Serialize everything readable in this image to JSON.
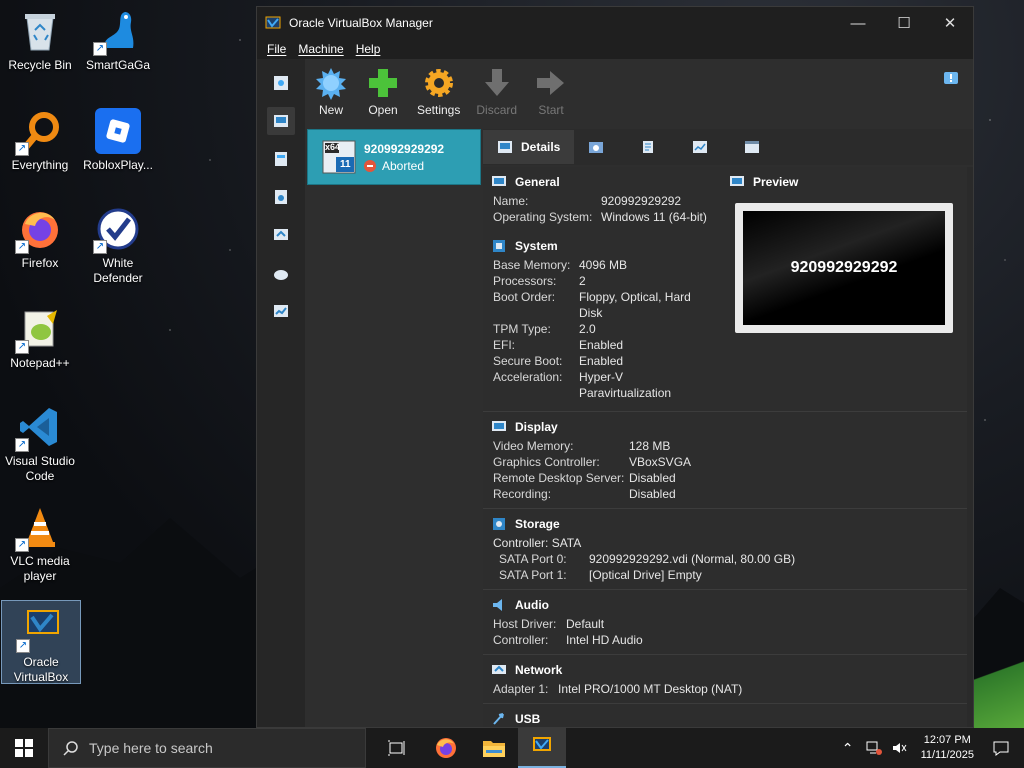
{
  "desktop": {
    "icons": [
      {
        "label": "Recycle Bin",
        "icon": "recycle-bin-icon"
      },
      {
        "label": "SmartGaGa",
        "icon": "smartgaga-icon"
      },
      {
        "label": "Everything",
        "icon": "everything-icon"
      },
      {
        "label": "RobloxPlay...",
        "icon": "roblox-icon"
      },
      {
        "label": "Firefox",
        "icon": "firefox-icon"
      },
      {
        "label": "White Defender",
        "icon": "white-defender-icon"
      },
      {
        "label": "Notepad++",
        "icon": "notepad-plus-plus-icon"
      },
      {
        "label": "Visual Studio Code",
        "icon": "vscode-icon"
      },
      {
        "label": "VLC media player",
        "icon": "vlc-icon"
      },
      {
        "label": "Oracle VirtualBox",
        "icon": "virtualbox-icon"
      }
    ]
  },
  "window": {
    "title": "Oracle VirtualBox Manager",
    "minimize": "—",
    "maximize": "☐",
    "close": "✕",
    "menu": [
      "File",
      "Machine",
      "Help"
    ]
  },
  "toolbar": {
    "new": "New",
    "open": "Open",
    "settings": "Settings",
    "discard": "Discard",
    "start": "Start"
  },
  "vm": {
    "name": "920992929292",
    "state": "Aborted",
    "os_badge_top": "x64",
    "os_badge_bottom": "11"
  },
  "tabs": {
    "details": "Details"
  },
  "details": {
    "general": {
      "title": "General",
      "rows": [
        {
          "k": "Name:",
          "v": "920992929292"
        },
        {
          "k": "Operating System:",
          "v": "Windows 11 (64-bit)"
        }
      ]
    },
    "system": {
      "title": "System",
      "rows": [
        {
          "k": "Base Memory:",
          "v": "4096 MB"
        },
        {
          "k": "Processors:",
          "v": "2"
        },
        {
          "k": "Boot Order:",
          "v": "Floppy, Optical, Hard Disk"
        },
        {
          "k": "TPM Type:",
          "v": "2.0"
        },
        {
          "k": "EFI:",
          "v": "Enabled"
        },
        {
          "k": "Secure Boot:",
          "v": "Enabled"
        },
        {
          "k": "Acceleration:",
          "v": "Hyper-V Paravirtualization"
        }
      ]
    },
    "preview": {
      "title": "Preview",
      "screen_text": "920992929292"
    },
    "display": {
      "title": "Display",
      "rows": [
        {
          "k": "Video Memory:",
          "v": "128 MB"
        },
        {
          "k": "Graphics Controller:",
          "v": "VBoxSVGA"
        },
        {
          "k": "Remote Desktop Server:",
          "v": "Disabled"
        },
        {
          "k": "Recording:",
          "v": "Disabled"
        }
      ]
    },
    "storage": {
      "title": "Storage",
      "controller": "Controller: SATA",
      "rows": [
        {
          "k": "SATA Port 0:",
          "v": "920992929292.vdi (Normal, 80.00 GB)"
        },
        {
          "k": "SATA Port 1:",
          "v": "[Optical Drive] Empty"
        }
      ]
    },
    "audio": {
      "title": "Audio",
      "rows": [
        {
          "k": "Host Driver:",
          "v": "Default"
        },
        {
          "k": "Controller:",
          "v": "Intel HD Audio"
        }
      ]
    },
    "network": {
      "title": "Network",
      "rows": [
        {
          "k": "Adapter 1:",
          "v": "Intel PRO/1000 MT Desktop (NAT)"
        }
      ]
    },
    "usb": {
      "title": "USB"
    }
  },
  "taskbar": {
    "search_placeholder": "Type here to search",
    "time": "12:07 PM",
    "date": "11/11/2025"
  },
  "colors": {
    "vm_selected": "#2d9eb3",
    "aborted": "#e2553b",
    "taskbar": "#1b1b1b"
  }
}
